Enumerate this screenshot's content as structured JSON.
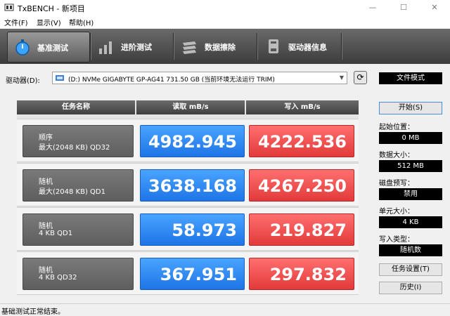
{
  "window": {
    "title": "TxBENCH - 新项目",
    "minimize": "—",
    "maximize": "☐",
    "close": "✕"
  },
  "menu": [
    "文件(F)",
    "显示(V)",
    "帮助(H)"
  ],
  "tabs": [
    {
      "label": "基准测试",
      "icon": "stopwatch-icon",
      "active": true
    },
    {
      "label": "进阶测试",
      "icon": "bar-chart-icon",
      "active": false
    },
    {
      "label": "数据擦除",
      "icon": "eraser-icon",
      "active": false
    },
    {
      "label": "驱动器信息",
      "icon": "drive-info-icon",
      "active": false
    }
  ],
  "drive": {
    "label": "驱动器(D):",
    "selected": "(D:) NVMe GIGABYTE GP-AG41  731.50 GB (当前环境无法运行 TRIM)"
  },
  "side": {
    "file_mode": "文件模式",
    "start": "开始(S)",
    "start_pos_label": "起始位置：",
    "start_pos_value": "0 MB",
    "data_size_label": "数据大小：",
    "data_size_value": "512 MB",
    "precondition_label": "磁盘预写：",
    "precondition_value": "禁用",
    "unit_size_label": "单元大小：",
    "unit_size_value": "4 KB",
    "write_type_label": "写入类型：",
    "write_type_value": "随机数",
    "task_settings": "任务设置(T)",
    "history": "历史(I)"
  },
  "table": {
    "headers": [
      "任务名称",
      "读取 mB/s",
      "写入 mB/s"
    ],
    "rows": [
      {
        "line1": "顺序",
        "line2": "最大(2048 KB) QD32",
        "read": "4982.945",
        "write": "4222.536"
      },
      {
        "line1": "随机",
        "line2": "最大(2048 KB) QD1",
        "read": "3638.168",
        "write": "4267.250"
      },
      {
        "line1": "随机",
        "line2": "4 KB QD1",
        "read": "58.973",
        "write": "219.827"
      },
      {
        "line1": "随机",
        "line2": "4 KB QD32",
        "read": "367.951",
        "write": "297.832"
      }
    ]
  },
  "status": "基础测试正常结束。",
  "colors": {
    "read": "#2f86f0",
    "write": "#ec4c4c",
    "toolbar": "#4a4a4a"
  }
}
